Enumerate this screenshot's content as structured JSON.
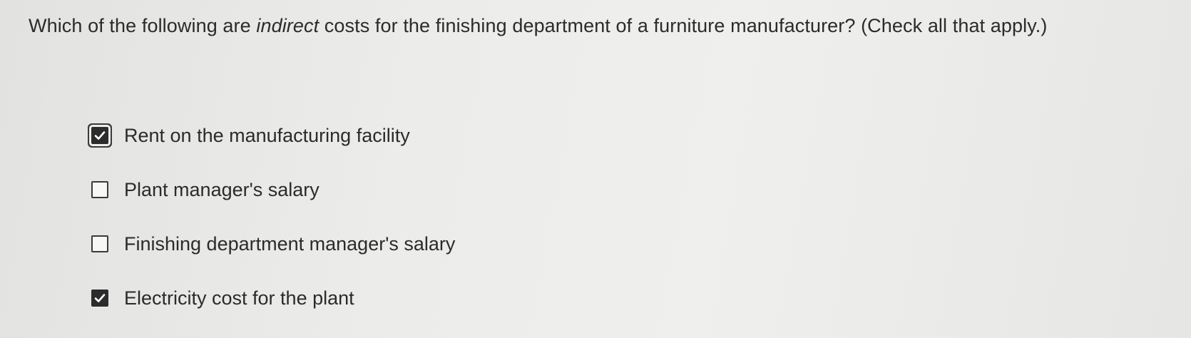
{
  "question": {
    "before": "Which of the following are ",
    "emphasis": "indirect",
    "after": " costs for the finishing department of a furniture manufacturer? (Check all that apply.)"
  },
  "options": [
    {
      "label": "Rent on the manufacturing facility",
      "checked": true,
      "focused": true
    },
    {
      "label": "Plant manager's salary",
      "checked": false,
      "focused": false
    },
    {
      "label": "Finishing department manager's salary",
      "checked": false,
      "focused": false
    },
    {
      "label": "Electricity cost for the plant",
      "checked": true,
      "focused": false
    }
  ],
  "icons": {
    "checked": "checkmark-icon"
  },
  "colors": {
    "checkbox_fill": "#2c2c2c",
    "checkmark": "#ffffff"
  }
}
